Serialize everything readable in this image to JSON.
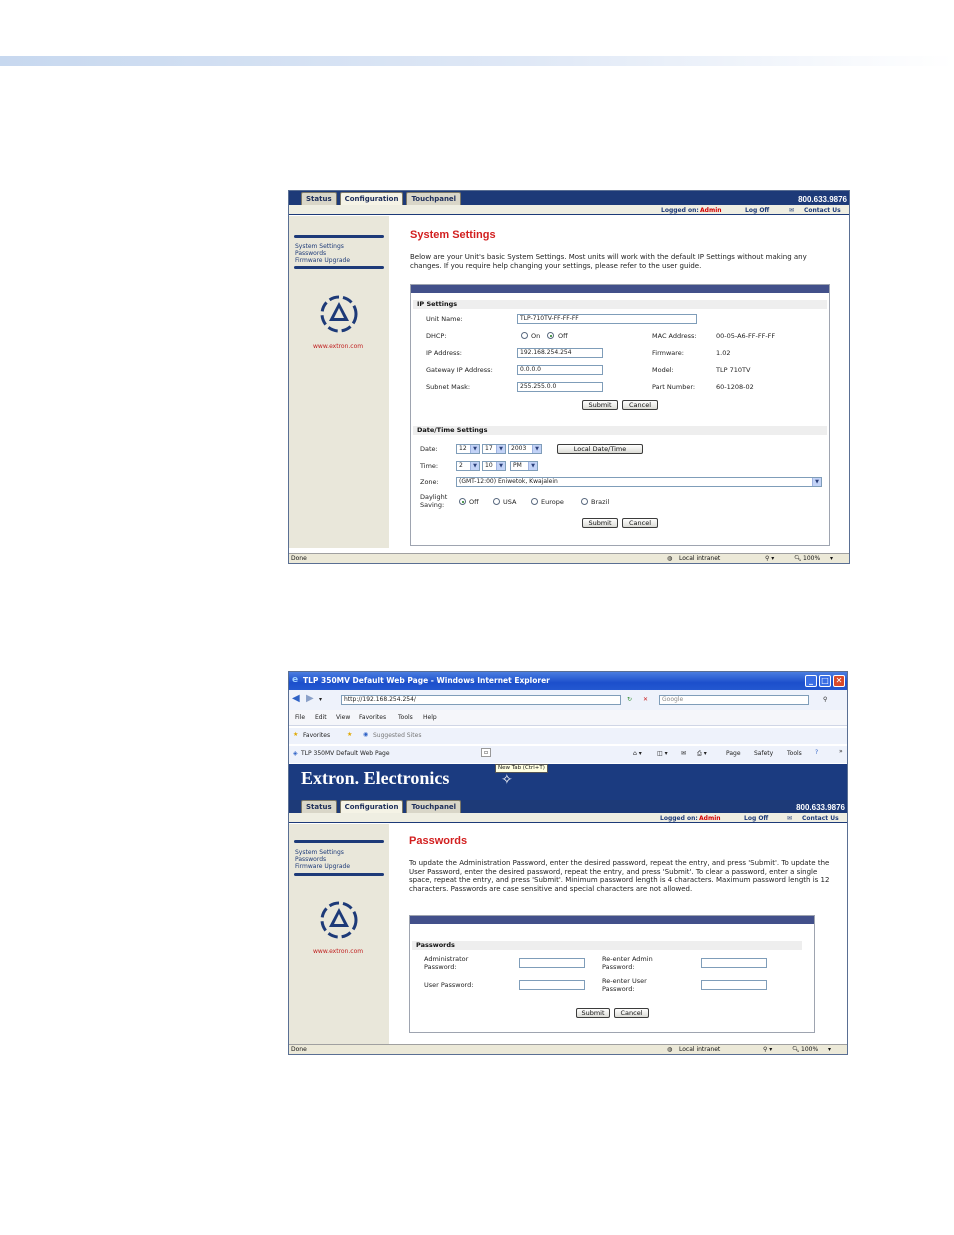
{
  "shot1": {
    "tabs": [
      "Status",
      "Configuration",
      "Touchpanel"
    ],
    "phone": "800.633.9876",
    "logged_label": "Logged on:",
    "logged_user": "Admin",
    "logoff": "Log Off",
    "contact": "Contact Us",
    "sidebar": [
      "System Settings",
      "Passwords",
      "Firmware Upgrade"
    ],
    "website": "www.extron.com",
    "title": "System Settings",
    "intro": "Below are your Unit's basic System Settings. Most units will work with the default IP Settings without making any changes. If you require help changing your settings, please refer to the user guide.",
    "ip": {
      "section": "IP Settings",
      "unit_name_label": "Unit Name:",
      "unit_name": "TLP-710TV-FF-FF-FF",
      "dhcp_label": "DHCP:",
      "dhcp_on": "On",
      "dhcp_off": "Off",
      "ip_label": "IP Address:",
      "ip": "192.168.254.254",
      "gw_label": "Gateway IP Address:",
      "gw": "0.0.0.0",
      "mask_label": "Subnet Mask:",
      "mask": "255.255.0.0",
      "mac_label": "MAC Address:",
      "mac": "00-05-A6-FF-FF-FF",
      "fw_label": "Firmware:",
      "fw": "1.02",
      "model_label": "Model:",
      "model": "TLP 710TV",
      "part_label": "Part Number:",
      "part": "60-1208-02",
      "submit": "Submit",
      "cancel": "Cancel"
    },
    "dt": {
      "section": "Date/Time Settings",
      "date_label": "Date:",
      "month": "12",
      "day": "17",
      "year": "2003",
      "local_btn": "Local Date/Time",
      "time_label": "Time:",
      "hour": "2",
      "minute": "10",
      "ampm": "PM",
      "zone_label": "Zone:",
      "zone": "(GMT-12:00) Eniwetok, Kwajalein",
      "daylight_label1": "Daylight",
      "daylight_label2": "Saving:",
      "opt_off": "Off",
      "opt_usa": "USA",
      "opt_europe": "Europe",
      "opt_brazil": "Brazil",
      "submit": "Submit",
      "cancel": "Cancel"
    },
    "status_done": "Done",
    "status_zone": "Local intranet",
    "zoom": "100%"
  },
  "shot2": {
    "window_title": "TLP 350MV Default Web Page - Windows Internet Explorer",
    "url": "http://192.168.254.254/",
    "search_placeholder": "Google",
    "menu": [
      "File",
      "Edit",
      "View",
      "Favorites",
      "Tools",
      "Help"
    ],
    "favorites": "Favorites",
    "suggested": "Suggested Sites",
    "tab_title": "TLP 350MV Default Web Page",
    "tooltip": "New Tab (Ctrl+T)",
    "cmd_page": "Page",
    "cmd_safety": "Safety",
    "cmd_tools": "Tools",
    "brand": "Extron. Electronics",
    "tabs": [
      "Status",
      "Configuration",
      "Touchpanel"
    ],
    "phone": "800.633.9876",
    "logged_label": "Logged on:",
    "logged_user": "Admin",
    "logoff": "Log Off",
    "contact": "Contact Us",
    "sidebar": [
      "System Settings",
      "Passwords",
      "Firmware Upgrade"
    ],
    "website": "www.extron.com",
    "title": "Passwords",
    "intro": "To update the Administration Password, enter the desired password, repeat the entry, and press 'Submit'. To update the User Password, enter the desired password, repeat the entry, and press 'Submit'. To clear a password, enter a single space, repeat the entry, and press 'Submit'. Minimum password length is 4 characters. Maximum password length is 12 characters. Passwords are case sensitive and special characters are not allowed.",
    "section": "Passwords",
    "admin_label1": "Administrator",
    "admin_label2": "Password:",
    "user_label": "User Password:",
    "readmin_label1": "Re-enter Admin",
    "readmin_label2": "Password:",
    "reuser_label1": "Re-enter User",
    "reuser_label2": "Password:",
    "submit": "Submit",
    "cancel": "Cancel",
    "status_done": "Done",
    "status_zone": "Local intranet",
    "zoom": "100%"
  }
}
